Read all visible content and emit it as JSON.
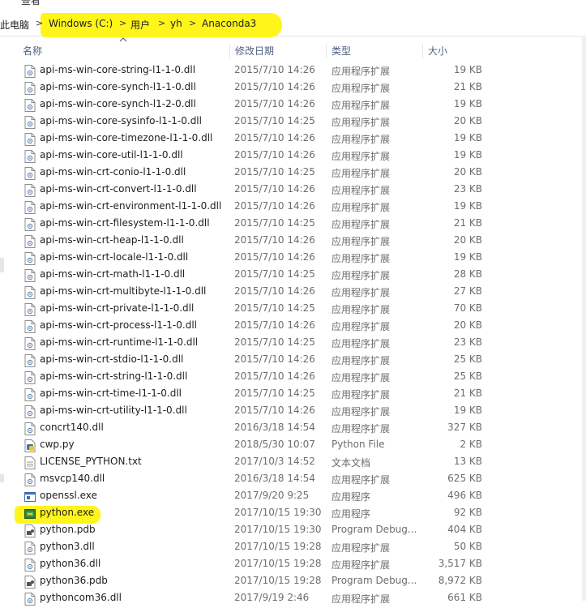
{
  "top": {
    "view_label": "查看"
  },
  "breadcrumb": {
    "root": "此电脑",
    "items": [
      "Windows (C:)",
      "用户",
      "yh",
      "Anaconda3"
    ],
    "separator": ">"
  },
  "columns": {
    "name": "名称",
    "date": "修改日期",
    "type": "类型",
    "size": "大小"
  },
  "highlight_color": "#fff51a",
  "files": [
    {
      "name": "api-ms-win-core-string-l1-1-0.dll",
      "date": "2015/7/10 14:26",
      "type": "应用程序扩展",
      "size": "19 KB",
      "icon": "dll-icon"
    },
    {
      "name": "api-ms-win-core-synch-l1-1-0.dll",
      "date": "2015/7/10 14:26",
      "type": "应用程序扩展",
      "size": "21 KB",
      "icon": "dll-icon"
    },
    {
      "name": "api-ms-win-core-synch-l1-2-0.dll",
      "date": "2015/7/10 14:26",
      "type": "应用程序扩展",
      "size": "19 KB",
      "icon": "dll-icon"
    },
    {
      "name": "api-ms-win-core-sysinfo-l1-1-0.dll",
      "date": "2015/7/10 14:25",
      "type": "应用程序扩展",
      "size": "20 KB",
      "icon": "dll-icon"
    },
    {
      "name": "api-ms-win-core-timezone-l1-1-0.dll",
      "date": "2015/7/10 14:26",
      "type": "应用程序扩展",
      "size": "19 KB",
      "icon": "dll-icon"
    },
    {
      "name": "api-ms-win-core-util-l1-1-0.dll",
      "date": "2015/7/10 14:26",
      "type": "应用程序扩展",
      "size": "19 KB",
      "icon": "dll-icon"
    },
    {
      "name": "api-ms-win-crt-conio-l1-1-0.dll",
      "date": "2015/7/10 14:25",
      "type": "应用程序扩展",
      "size": "20 KB",
      "icon": "dll-icon"
    },
    {
      "name": "api-ms-win-crt-convert-l1-1-0.dll",
      "date": "2015/7/10 14:26",
      "type": "应用程序扩展",
      "size": "23 KB",
      "icon": "dll-icon"
    },
    {
      "name": "api-ms-win-crt-environment-l1-1-0.dll",
      "date": "2015/7/10 14:26",
      "type": "应用程序扩展",
      "size": "19 KB",
      "icon": "dll-icon"
    },
    {
      "name": "api-ms-win-crt-filesystem-l1-1-0.dll",
      "date": "2015/7/10 14:25",
      "type": "应用程序扩展",
      "size": "21 KB",
      "icon": "dll-icon"
    },
    {
      "name": "api-ms-win-crt-heap-l1-1-0.dll",
      "date": "2015/7/10 14:26",
      "type": "应用程序扩展",
      "size": "20 KB",
      "icon": "dll-icon"
    },
    {
      "name": "api-ms-win-crt-locale-l1-1-0.dll",
      "date": "2015/7/10 14:26",
      "type": "应用程序扩展",
      "size": "19 KB",
      "icon": "dll-icon"
    },
    {
      "name": "api-ms-win-crt-math-l1-1-0.dll",
      "date": "2015/7/10 14:25",
      "type": "应用程序扩展",
      "size": "28 KB",
      "icon": "dll-icon"
    },
    {
      "name": "api-ms-win-crt-multibyte-l1-1-0.dll",
      "date": "2015/7/10 14:26",
      "type": "应用程序扩展",
      "size": "27 KB",
      "icon": "dll-icon"
    },
    {
      "name": "api-ms-win-crt-private-l1-1-0.dll",
      "date": "2015/7/10 14:25",
      "type": "应用程序扩展",
      "size": "70 KB",
      "icon": "dll-icon"
    },
    {
      "name": "api-ms-win-crt-process-l1-1-0.dll",
      "date": "2015/7/10 14:26",
      "type": "应用程序扩展",
      "size": "20 KB",
      "icon": "dll-icon"
    },
    {
      "name": "api-ms-win-crt-runtime-l1-1-0.dll",
      "date": "2015/7/10 14:25",
      "type": "应用程序扩展",
      "size": "23 KB",
      "icon": "dll-icon"
    },
    {
      "name": "api-ms-win-crt-stdio-l1-1-0.dll",
      "date": "2015/7/10 14:26",
      "type": "应用程序扩展",
      "size": "25 KB",
      "icon": "dll-icon"
    },
    {
      "name": "api-ms-win-crt-string-l1-1-0.dll",
      "date": "2015/7/10 14:26",
      "type": "应用程序扩展",
      "size": "25 KB",
      "icon": "dll-icon"
    },
    {
      "name": "api-ms-win-crt-time-l1-1-0.dll",
      "date": "2015/7/10 14:25",
      "type": "应用程序扩展",
      "size": "21 KB",
      "icon": "dll-icon"
    },
    {
      "name": "api-ms-win-crt-utility-l1-1-0.dll",
      "date": "2015/7/10 14:26",
      "type": "应用程序扩展",
      "size": "19 KB",
      "icon": "dll-icon"
    },
    {
      "name": "concrt140.dll",
      "date": "2016/3/18 14:54",
      "type": "应用程序扩展",
      "size": "327 KB",
      "icon": "dll-icon"
    },
    {
      "name": "cwp.py",
      "date": "2018/5/30 10:07",
      "type": "Python File",
      "size": "2 KB",
      "icon": "python-file-icon"
    },
    {
      "name": "LICENSE_PYTHON.txt",
      "date": "2017/10/3 14:52",
      "type": "文本文档",
      "size": "13 KB",
      "icon": "text-file-icon"
    },
    {
      "name": "msvcp140.dll",
      "date": "2016/3/18 14:54",
      "type": "应用程序扩展",
      "size": "625 KB",
      "icon": "dll-icon"
    },
    {
      "name": "openssl.exe",
      "date": "2017/9/20 9:25",
      "type": "应用程序",
      "size": "496 KB",
      "icon": "exe-icon"
    },
    {
      "name": "python.exe",
      "date": "2017/10/15 19:30",
      "type": "应用程序",
      "size": "92 KB",
      "icon": "python-exe-icon"
    },
    {
      "name": "python.pdb",
      "date": "2017/10/15 19:30",
      "type": "Program Debug...",
      "size": "404 KB",
      "icon": "pdb-icon"
    },
    {
      "name": "python3.dll",
      "date": "2017/10/15 19:28",
      "type": "应用程序扩展",
      "size": "50 KB",
      "icon": "dll-icon"
    },
    {
      "name": "python36.dll",
      "date": "2017/10/15 19:28",
      "type": "应用程序扩展",
      "size": "3,517 KB",
      "icon": "dll-icon"
    },
    {
      "name": "python36.pdb",
      "date": "2017/10/15 19:28",
      "type": "Program Debug...",
      "size": "8,972 KB",
      "icon": "pdb-icon"
    },
    {
      "name": "pythoncom36.dll",
      "date": "2017/9/19 2:46",
      "type": "应用程序扩展",
      "size": "661 KB",
      "icon": "dll-icon"
    }
  ]
}
